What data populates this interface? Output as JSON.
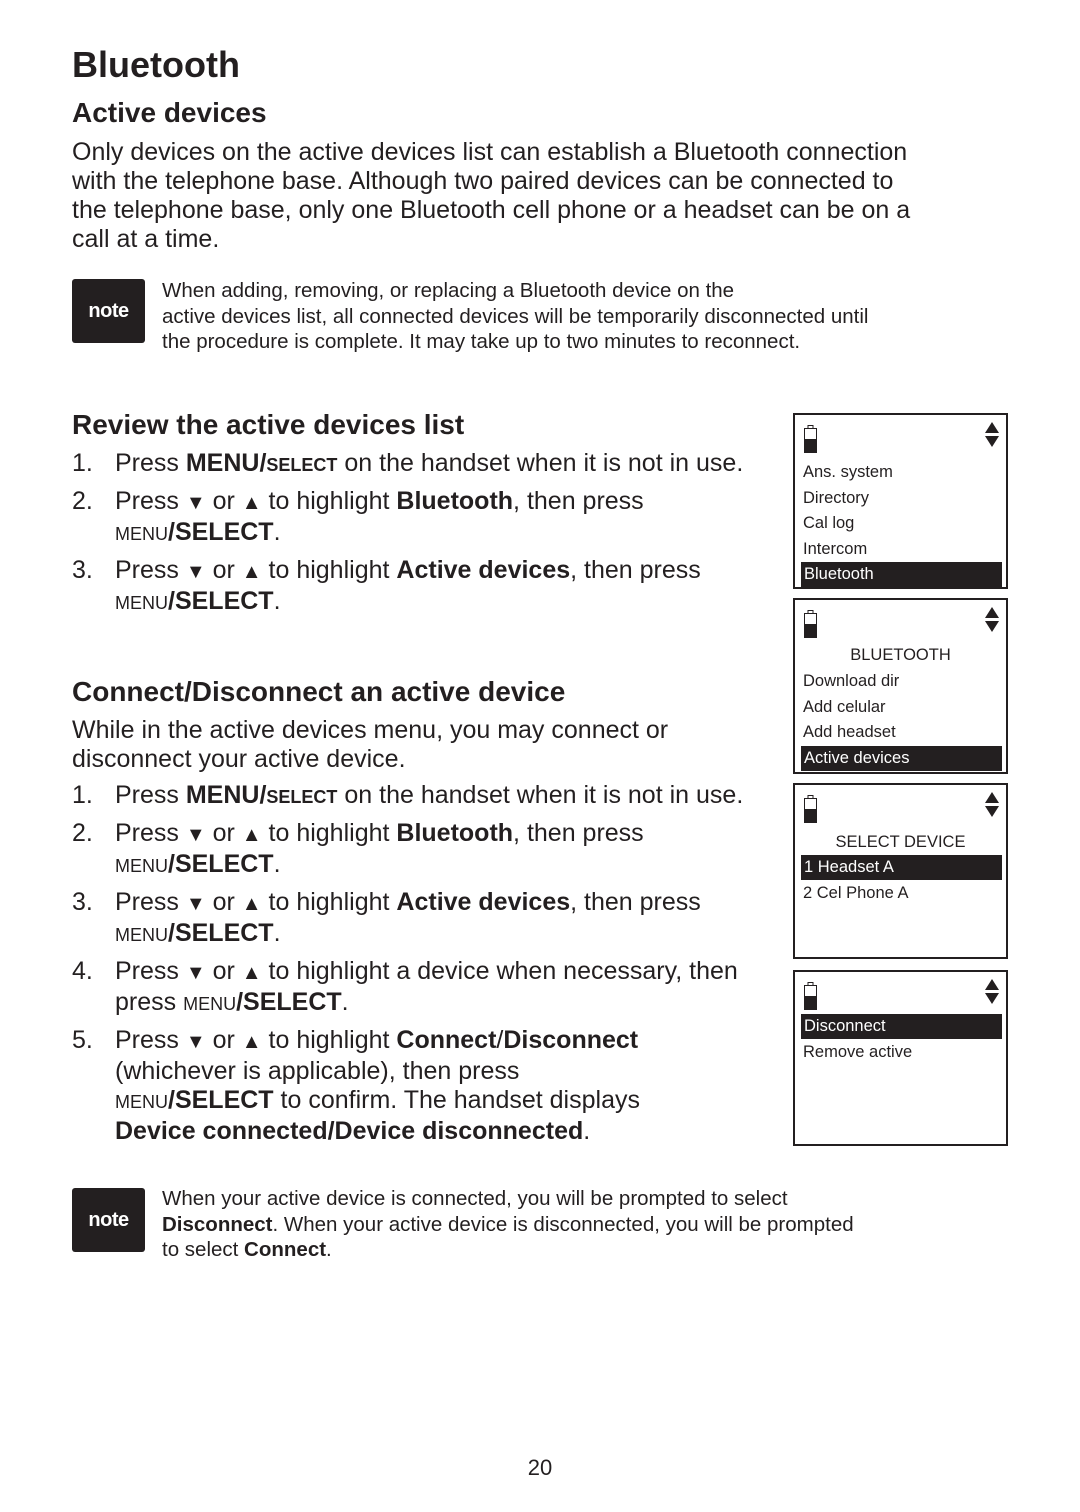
{
  "page": {
    "title": "Bluetooth",
    "page_number": "20"
  },
  "active_devices": {
    "heading": "Active devices",
    "body_lines": [
      "Only devices on the active devices list can establish a Bluetooth connection",
      "with the telephone base. Although two paired devices can be connected to",
      "the telephone base, only one Bluetooth cell phone or a headset can be on a",
      "call at a time."
    ],
    "note": {
      "badge": "note",
      "lines": [
        "When adding, removing, or replacing a Bluetooth device on the",
        "active devices list, all connected devices will be temporarily disconnected until",
        "the procedure is complete. It may take up to two minutes to reconnect."
      ]
    }
  },
  "review": {
    "heading": "Review the active devices list",
    "steps": [
      {
        "num": "1.",
        "a": "Press ",
        "b": "MENU/",
        "c": "SELECT",
        "d": " on the handset when it is not in use."
      },
      {
        "num": "2.",
        "a": "Press ",
        "down": "▼",
        "or": " or ",
        "up": "▲",
        "e": " to highlight ",
        "bold": "Bluetooth",
        "f": ", then press ",
        "menu": "MENU",
        "sel": "/SELECT",
        "end": "."
      },
      {
        "num": "3.",
        "a": "Press ",
        "down": "▼",
        "or": " or ",
        "up": "▲",
        "e": " to highlight ",
        "bold": "Active devices",
        "f": ", then press ",
        "menu": "MENU",
        "sel": "/SELECT",
        "end": "."
      }
    ]
  },
  "connect": {
    "heading": "Connect/Disconnect an active device",
    "intro_lines": [
      "While in the active devices menu, you may connect or",
      "disconnect your active device."
    ],
    "steps": [
      {
        "num": "1.",
        "a": "Press ",
        "b": "MENU/",
        "c": "SELECT",
        "d": " on the handset when it is not in use."
      },
      {
        "num": "2.",
        "a": "Press ",
        "down": "▼",
        "or": " or ",
        "up": "▲",
        "e": " to highlight ",
        "bold": "Bluetooth",
        "f": ", then press ",
        "menu": "MENU",
        "sel": "/SELECT",
        "end": "."
      },
      {
        "num": "3.",
        "a": "Press ",
        "down": "▼",
        "or": " or ",
        "up": "▲",
        "e": " to highlight ",
        "bold": "Active devices",
        "f": ", then press ",
        "menu": "MENU",
        "sel": "/SELECT",
        "end": "."
      },
      {
        "num": "4.",
        "a": "Press ",
        "down": "▼",
        "or": " or ",
        "up": "▲",
        "e": " to highlight a device when necessary, then press ",
        "menu": "MENU",
        "sel": "/SELECT",
        "end": "."
      },
      {
        "num": "5.",
        "a": "Press ",
        "down": "▼",
        "or": " or ",
        "up": "▲",
        "e": " to highlight ",
        "bold": "Connect",
        "slash": "/",
        "bold2": "Disconnect",
        "f": " (whichever is applicable), then press ",
        "menu": "MENU",
        "sel": "/SELECT",
        "g": " to confirm. The handset displays ",
        "bold3": "Device connected/Device disconnected",
        "end": "."
      }
    ],
    "note": {
      "badge": "note",
      "line1": "When your active device is connected, you will be prompted to select",
      "l2_bold": "Disconnect",
      "l2_rest": ". When your active device is disconnected, you will be prompted",
      "l3_pre": "to select ",
      "l3_bold": "Connect",
      "l3_end": "."
    }
  },
  "screens": [
    {
      "title": "",
      "items": [
        "Ans. system",
        "Directory",
        "Cal log",
        "Intercom",
        "Bluetooth"
      ],
      "highlighted": 4
    },
    {
      "title": "BLUETOOTH",
      "items": [
        "Download dir",
        "Add celular",
        "Add headset",
        "Active devices"
      ],
      "highlighted": 3
    },
    {
      "title": "SELECT DEVICE",
      "items": [
        "1 Headset A",
        "2 Cel Phone A"
      ],
      "highlighted": 0
    },
    {
      "title": "",
      "items": [
        "Disconnect",
        "Remove active"
      ],
      "highlighted": 0
    }
  ]
}
